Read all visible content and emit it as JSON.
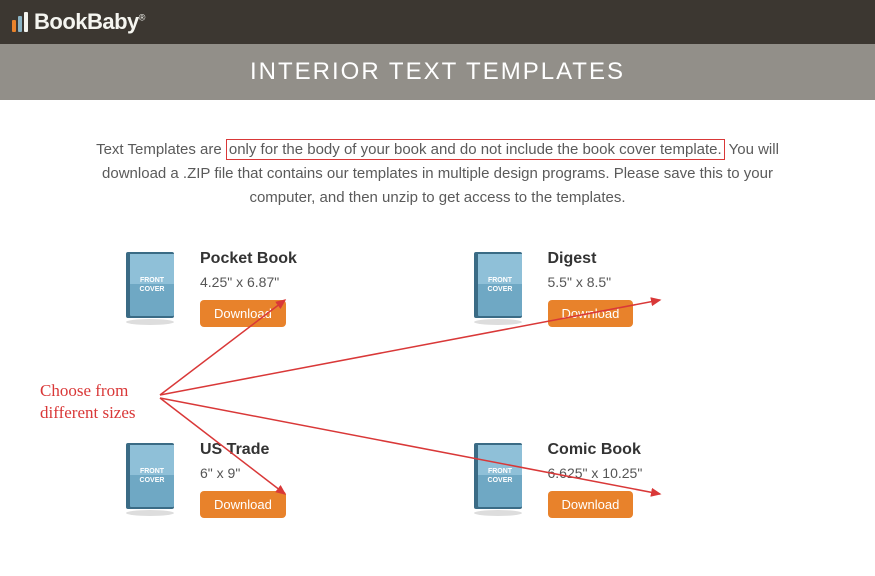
{
  "brand": {
    "name": "BookBaby"
  },
  "header": {
    "title": "INTERIOR TEXT TEMPLATES"
  },
  "description": {
    "prefix": "Text Templates are ",
    "highlighted": "only for the body of your book and do not include the book cover template.",
    "suffix": " You will download a .ZIP file that contains our templates in multiple design programs. Please save this to your computer, and then unzip to get access to the templates."
  },
  "templates": [
    {
      "title": "Pocket Book",
      "size": "4.25\" x 6.87\"",
      "download_label": "Download"
    },
    {
      "title": "Digest",
      "size": "5.5\" x 8.5\"",
      "download_label": "Download"
    },
    {
      "title": "US Trade",
      "size": "6\" x 9\"",
      "download_label": "Download"
    },
    {
      "title": "Comic Book",
      "size": "6.625\" x 10.25\"",
      "download_label": "Download"
    }
  ],
  "annotation": {
    "line1": "Choose from",
    "line2": "different sizes"
  },
  "book_icon_label": "FRONT COVER"
}
